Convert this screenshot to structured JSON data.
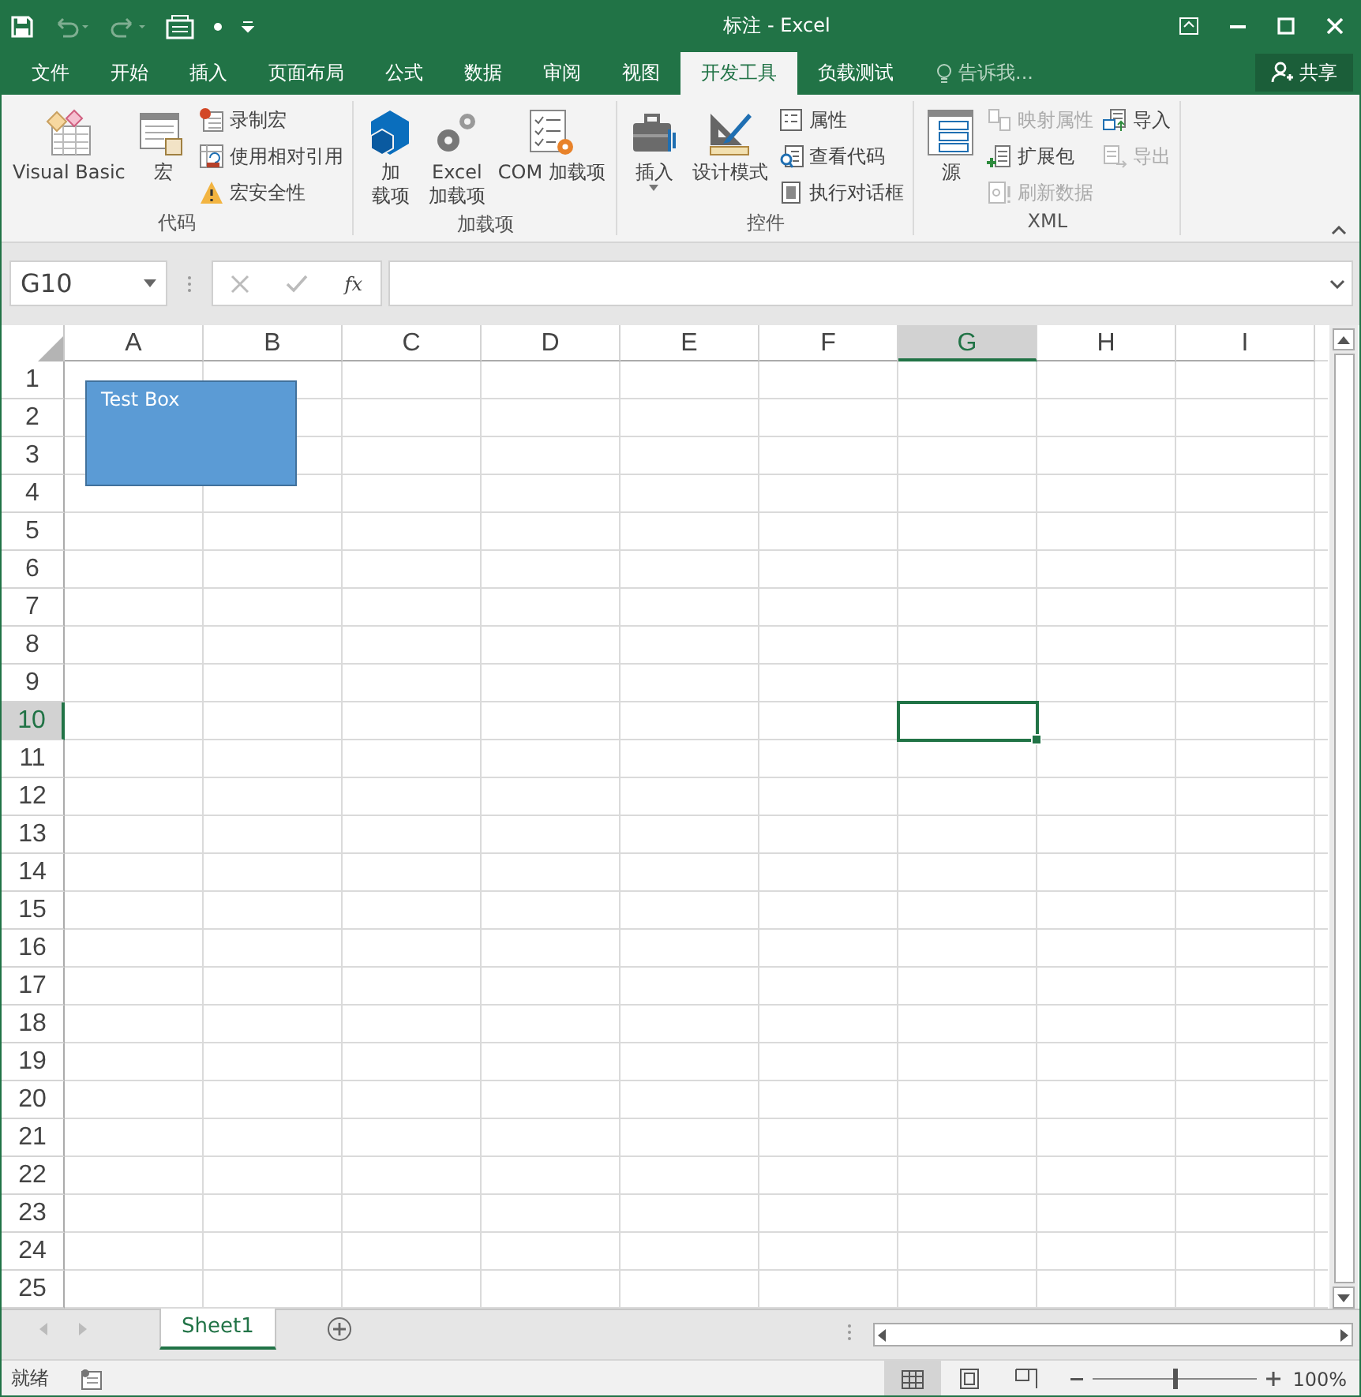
{
  "window": {
    "title": "标注 - Excel"
  },
  "tabs": [
    {
      "label": "文件",
      "selected": false
    },
    {
      "label": "开始",
      "selected": false
    },
    {
      "label": "插入",
      "selected": false
    },
    {
      "label": "页面布局",
      "selected": false
    },
    {
      "label": "公式",
      "selected": false
    },
    {
      "label": "数据",
      "selected": false
    },
    {
      "label": "审阅",
      "selected": false
    },
    {
      "label": "视图",
      "selected": false
    },
    {
      "label": "开发工具",
      "selected": true
    },
    {
      "label": "负载测试",
      "selected": false
    }
  ],
  "tell_me": {
    "placeholder": "告诉我..."
  },
  "share": {
    "label": "共享"
  },
  "ribbon": {
    "groups": [
      {
        "label": "代码",
        "columns": [
          {
            "kind": "large",
            "lines": [
              "Visual Basic"
            ],
            "disabled": false
          },
          {
            "kind": "large",
            "lines": [
              "宏"
            ],
            "disabled": false
          },
          {
            "kind": "stack",
            "items": [
              {
                "label": "录制宏",
                "disabled": false
              },
              {
                "label": "使用相对引用",
                "disabled": false
              },
              {
                "label": "宏安全性",
                "disabled": false
              }
            ]
          }
        ]
      },
      {
        "label": "加载项",
        "columns": [
          {
            "kind": "large",
            "lines": [
              "加",
              "载项"
            ],
            "disabled": false
          },
          {
            "kind": "large",
            "lines": [
              "Excel",
              "加载项"
            ],
            "disabled": false
          },
          {
            "kind": "large",
            "lines": [
              "COM 加载项"
            ],
            "disabled": false
          }
        ]
      },
      {
        "label": "控件",
        "columns": [
          {
            "kind": "dropdown",
            "lines": [
              "插入"
            ],
            "disabled": false
          },
          {
            "kind": "large",
            "lines": [
              "设计模式"
            ],
            "disabled": false
          },
          {
            "kind": "stack",
            "items": [
              {
                "label": "属性",
                "disabled": false
              },
              {
                "label": "查看代码",
                "disabled": false
              },
              {
                "label": "执行对话框",
                "disabled": false
              }
            ]
          }
        ]
      },
      {
        "label": "XML",
        "columns": [
          {
            "kind": "large",
            "lines": [
              "源"
            ],
            "disabled": false
          },
          {
            "kind": "stack",
            "items": [
              {
                "label": "映射属性",
                "disabled": true
              },
              {
                "label": "扩展包",
                "disabled": false
              },
              {
                "label": "刷新数据",
                "disabled": true
              }
            ]
          },
          {
            "kind": "stack",
            "items": [
              {
                "label": "导入",
                "disabled": false
              },
              {
                "label": "导出",
                "disabled": true
              }
            ]
          }
        ]
      }
    ]
  },
  "formula_bar": {
    "name_box": "G10",
    "function_label": "fx"
  },
  "sheet": {
    "columns": [
      {
        "label": "A",
        "selected": false
      },
      {
        "label": "B",
        "selected": false
      },
      {
        "label": "C",
        "selected": false
      },
      {
        "label": "D",
        "selected": false
      },
      {
        "label": "E",
        "selected": false
      },
      {
        "label": "F",
        "selected": false
      },
      {
        "label": "G",
        "selected": true
      },
      {
        "label": "H",
        "selected": false
      },
      {
        "label": "I",
        "selected": false
      }
    ],
    "rows": [
      {
        "label": "1",
        "selected": false
      },
      {
        "label": "2",
        "selected": false
      },
      {
        "label": "3",
        "selected": false
      },
      {
        "label": "4",
        "selected": false
      },
      {
        "label": "5",
        "selected": false
      },
      {
        "label": "6",
        "selected": false
      },
      {
        "label": "7",
        "selected": false
      },
      {
        "label": "8",
        "selected": false
      },
      {
        "label": "9",
        "selected": false
      },
      {
        "label": "10",
        "selected": true
      },
      {
        "label": "11",
        "selected": false
      },
      {
        "label": "12",
        "selected": false
      },
      {
        "label": "13",
        "selected": false
      },
      {
        "label": "14",
        "selected": false
      },
      {
        "label": "15",
        "selected": false
      },
      {
        "label": "16",
        "selected": false
      },
      {
        "label": "17",
        "selected": false
      },
      {
        "label": "18",
        "selected": false
      },
      {
        "label": "19",
        "selected": false
      },
      {
        "label": "20",
        "selected": false
      },
      {
        "label": "21",
        "selected": false
      },
      {
        "label": "22",
        "selected": false
      },
      {
        "label": "23",
        "selected": false
      },
      {
        "label": "24",
        "selected": false
      },
      {
        "label": "25",
        "selected": false
      }
    ],
    "text_box": {
      "text": "Test Box"
    }
  },
  "sheet_tabs": [
    {
      "label": "Sheet1",
      "selected": true
    }
  ],
  "status_bar": {
    "status": "就绪",
    "view_buttons": [
      {
        "kind": "normal",
        "selected": true
      },
      {
        "kind": "page_layout",
        "selected": false
      },
      {
        "kind": "page_break",
        "selected": false
      }
    ],
    "zoom": {
      "level": 0.5,
      "reading": "100%"
    }
  }
}
